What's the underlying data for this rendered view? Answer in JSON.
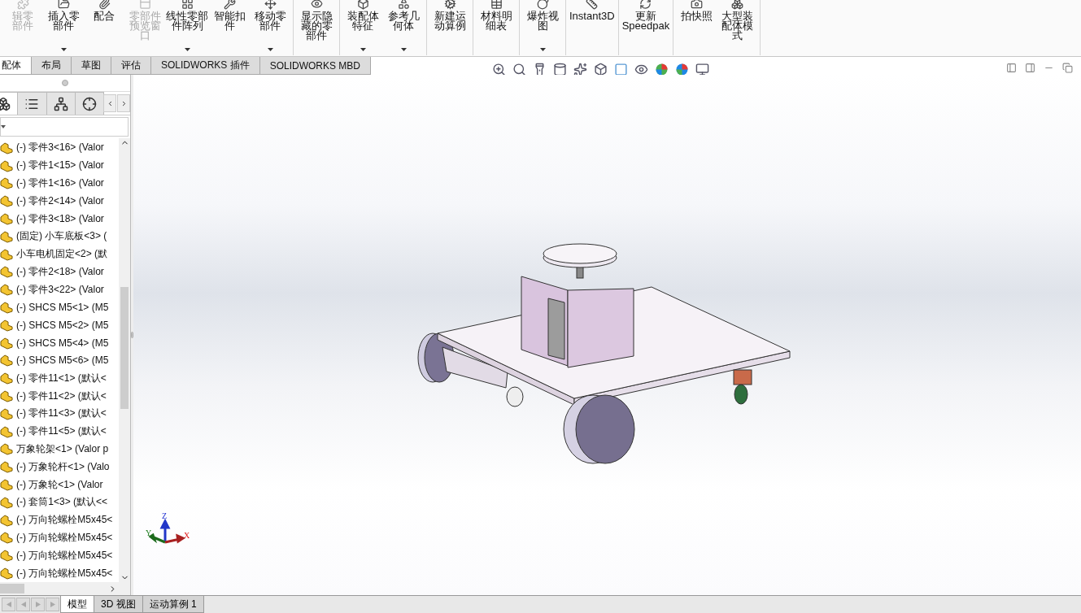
{
  "ribbon": {
    "groups": [
      {
        "buttons": [
          {
            "lines": [
              "辑零",
              "部件"
            ],
            "disabled": true,
            "dropdown": false
          },
          {
            "lines": [
              "插入零",
              "部件"
            ],
            "disabled": false,
            "dropdown": true
          },
          {
            "lines": [
              "配合"
            ],
            "disabled": false,
            "dropdown": false
          },
          {
            "lines": [
              "零部件",
              "预览窗",
              "口"
            ],
            "disabled": true,
            "dropdown": false
          },
          {
            "lines": [
              "线性零部",
              "件阵列"
            ],
            "disabled": false,
            "dropdown": true
          },
          {
            "lines": [
              "智能扣",
              "件"
            ],
            "disabled": false,
            "dropdown": false
          },
          {
            "lines": [
              "移动零",
              "部件"
            ],
            "disabled": false,
            "dropdown": true
          }
        ]
      },
      {
        "buttons": [
          {
            "lines": [
              "显示隐",
              "藏的零",
              "部件"
            ],
            "disabled": false,
            "dropdown": false
          }
        ]
      },
      {
        "buttons": [
          {
            "lines": [
              "装配体",
              "特征"
            ],
            "disabled": false,
            "dropdown": true
          },
          {
            "lines": [
              "参考几",
              "何体"
            ],
            "disabled": false,
            "dropdown": true
          }
        ]
      },
      {
        "buttons": [
          {
            "lines": [
              "新建运",
              "动算例"
            ],
            "disabled": false,
            "dropdown": false
          }
        ]
      },
      {
        "buttons": [
          {
            "lines": [
              "材料明",
              "细表"
            ],
            "disabled": false,
            "dropdown": false
          }
        ]
      },
      {
        "buttons": [
          {
            "lines": [
              "爆炸视",
              "图"
            ],
            "disabled": false,
            "dropdown": true
          }
        ]
      },
      {
        "buttons": [
          {
            "lines": [
              "Instant3D"
            ],
            "disabled": false,
            "dropdown": false
          }
        ]
      },
      {
        "buttons": [
          {
            "lines": [
              "更新",
              "Speedpak"
            ],
            "disabled": false,
            "dropdown": false
          }
        ]
      },
      {
        "buttons": [
          {
            "lines": [
              "拍快照"
            ],
            "disabled": false,
            "dropdown": false
          },
          {
            "lines": [
              "大型装",
              "配体模",
              "式"
            ],
            "disabled": false,
            "dropdown": false
          }
        ]
      }
    ]
  },
  "command_tabs": [
    {
      "label": "配体",
      "selected": true
    },
    {
      "label": "布局",
      "selected": false
    },
    {
      "label": "草图",
      "selected": false
    },
    {
      "label": "评估",
      "selected": false
    },
    {
      "label": "SOLIDWORKS 插件",
      "selected": false
    },
    {
      "label": "SOLIDWORKS MBD",
      "selected": false
    }
  ],
  "panel_tabs": [
    {
      "selected": true
    },
    {
      "selected": false
    },
    {
      "selected": false
    },
    {
      "selected": false
    }
  ],
  "feature_tree": {
    "items": [
      {
        "label": "(-) 零件3<16> (Valor"
      },
      {
        "label": "(-) 零件1<15> (Valor"
      },
      {
        "label": "(-) 零件1<16> (Valor"
      },
      {
        "label": "(-) 零件2<14> (Valor"
      },
      {
        "label": "(-) 零件3<18> (Valor"
      },
      {
        "label": "(固定) 小车底板<3> ("
      },
      {
        "label": "小车电机固定<2> (默"
      },
      {
        "label": "(-) 零件2<18> (Valor"
      },
      {
        "label": "(-) 零件3<22> (Valor"
      },
      {
        "label": "(-) SHCS M5<1> (M5"
      },
      {
        "label": "(-) SHCS M5<2> (M5"
      },
      {
        "label": "(-) SHCS M5<4> (M5"
      },
      {
        "label": "(-) SHCS M5<6> (M5"
      },
      {
        "label": "(-) 零件11<1> (默认<"
      },
      {
        "label": "(-) 零件11<2> (默认<"
      },
      {
        "label": "(-) 零件11<3> (默认<"
      },
      {
        "label": "(-) 零件11<5> (默认<"
      },
      {
        "label": "万象轮架<1> (Valor p"
      },
      {
        "label": "(-) 万象轮杆<1> (Valo"
      },
      {
        "label": "(-) 万象轮<1> (Valor"
      },
      {
        "label": "(-) 套筒1<3> (默认<<"
      },
      {
        "label": "(-) 万向轮螺栓M5x45<"
      },
      {
        "label": "(-) 万向轮螺栓M5x45<"
      },
      {
        "label": "(-) 万向轮螺栓M5x45<"
      },
      {
        "label": "(-) 万向轮螺栓M5x45<"
      }
    ]
  },
  "viewport": {
    "triad": {
      "z": "Z",
      "y": "Y",
      "x": "X"
    }
  },
  "bottom_tabs": [
    {
      "label": "模型",
      "selected": true
    },
    {
      "label": "3D 视图",
      "selected": false
    },
    {
      "label": "运动算例 1",
      "selected": false
    }
  ]
}
